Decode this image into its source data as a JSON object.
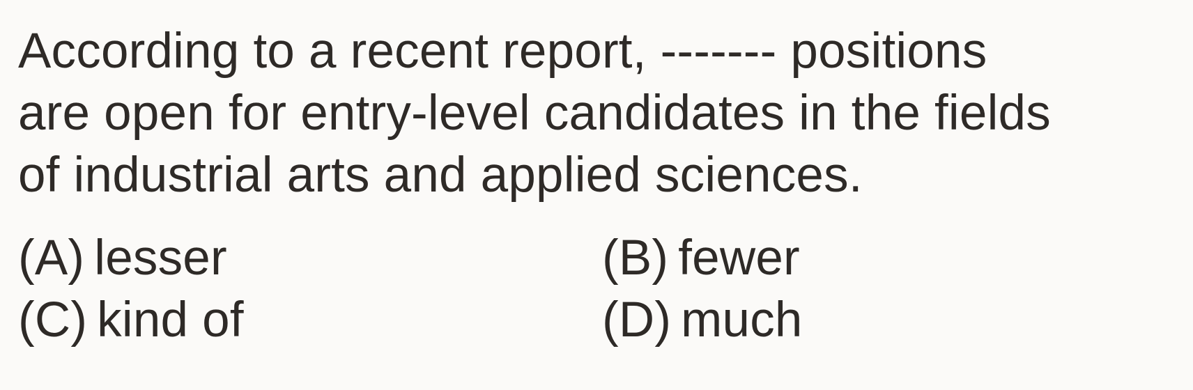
{
  "question": {
    "lines": [
      "According to a recent report, ------- positions",
      "are open for entry-level candidates in the fields",
      "of industrial arts and applied sciences."
    ]
  },
  "options": [
    {
      "letter": "(A)",
      "text": "lesser"
    },
    {
      "letter": "(B)",
      "text": "fewer"
    },
    {
      "letter": "(C)",
      "text": "kind of"
    },
    {
      "letter": "(D)",
      "text": "much"
    }
  ]
}
